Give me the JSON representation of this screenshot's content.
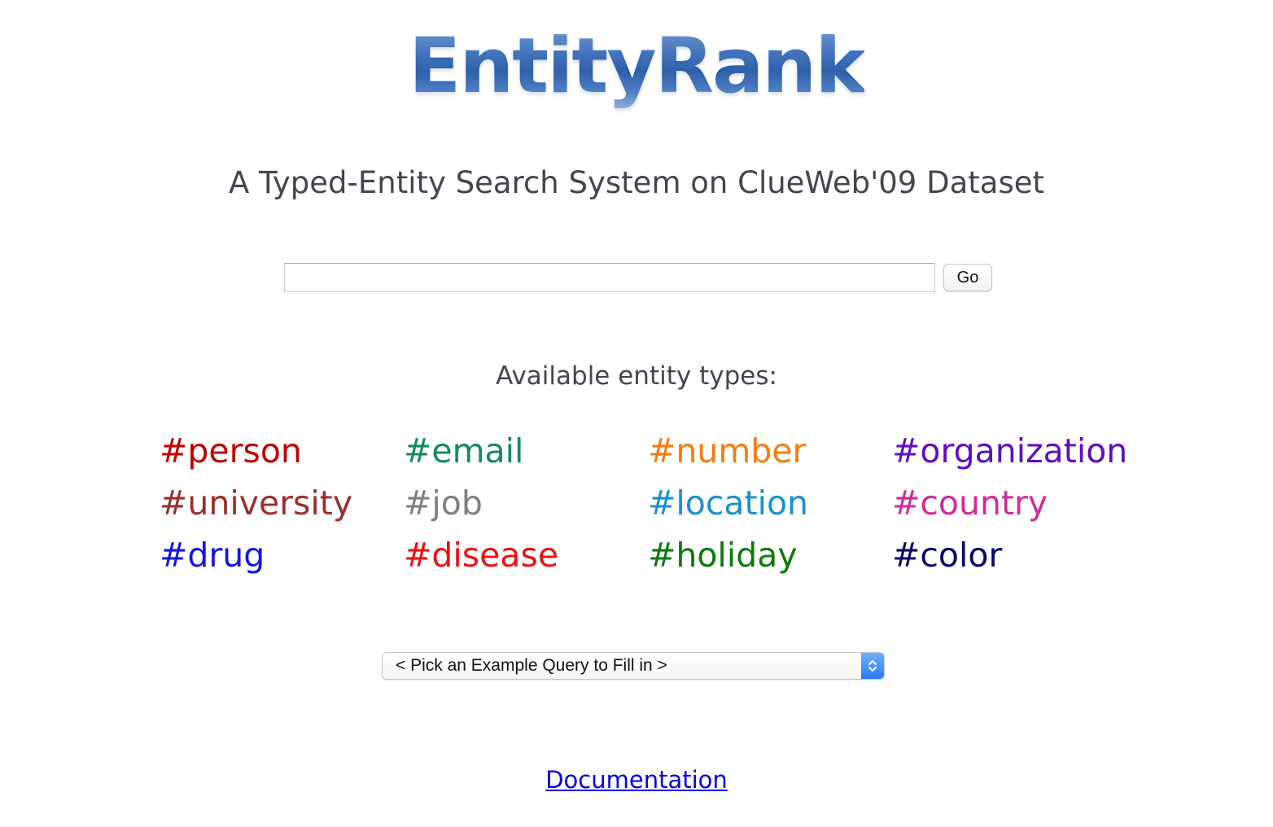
{
  "logo": {
    "text": "EntityRank"
  },
  "subtitle": "A Typed-Entity Search System on ClueWeb'09 Dataset",
  "search": {
    "value": "",
    "placeholder": "",
    "go_label": "Go"
  },
  "types_heading": "Available entity types:",
  "entity_types": [
    {
      "label": "#person",
      "color": "#c00000"
    },
    {
      "label": "#email",
      "color": "#138a5f"
    },
    {
      "label": "#number",
      "color": "#f57b11"
    },
    {
      "label": "#organization",
      "color": "#5d0ec2"
    },
    {
      "label": "#university",
      "color": "#9b2e2e"
    },
    {
      "label": "#job",
      "color": "#808080"
    },
    {
      "label": "#location",
      "color": "#1a91cc"
    },
    {
      "label": "#country",
      "color": "#d12b97"
    },
    {
      "label": "#drug",
      "color": "#1414e6"
    },
    {
      "label": "#disease",
      "color": "#ee1111"
    },
    {
      "label": "#holiday",
      "color": "#0d7a0d"
    },
    {
      "label": "#color",
      "color": "#0a0a66"
    }
  ],
  "example_select": {
    "selected": "< Pick an Example Query to Fill in >"
  },
  "documentation_link": "Documentation",
  "colors": {
    "logo_blue": "#1f56ab",
    "text_gray": "#45454f",
    "link_blue": "#0000ee",
    "select_accent": "#2a7cf0"
  }
}
